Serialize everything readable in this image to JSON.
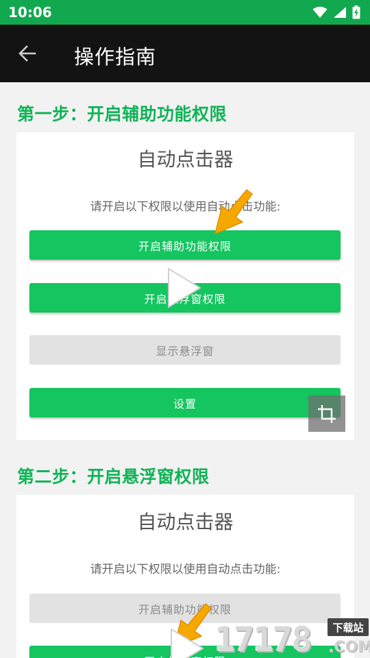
{
  "status_bar": {
    "time": "10:06",
    "icons": [
      "wifi-icon",
      "signal-icon",
      "battery-icon"
    ]
  },
  "app_bar": {
    "back_icon": "arrow-left-icon",
    "title": "操作指南"
  },
  "steps": [
    {
      "heading": "第一步：开启辅助功能权限",
      "card": {
        "title": "自动点击器",
        "subtitle": "请开启以下权限以使用自动点击功能:",
        "buttons": [
          {
            "label": "开启辅助功能权限",
            "style": "green"
          },
          {
            "label": "开启悬浮窗权限",
            "style": "green"
          },
          {
            "label": "显示悬浮窗",
            "style": "gray"
          },
          {
            "label": "设置",
            "style": "green"
          }
        ]
      }
    },
    {
      "heading": "第二步：开启悬浮窗权限",
      "card": {
        "title": "自动点击器",
        "subtitle": "请开启以下权限以使用自动点击功能:",
        "buttons": [
          {
            "label": "开启辅助功能权限",
            "style": "gray"
          },
          {
            "label": "开启悬浮窗权限",
            "style": "green"
          }
        ]
      }
    }
  ],
  "overlays": {
    "play_icon": "play-icon",
    "pointer_arrow_icon": "pointer-arrow-icon",
    "crop_icon": "crop-icon"
  },
  "watermark": {
    "digits": "17178",
    "domain": ".COM",
    "site": "下载站"
  },
  "colors": {
    "status_bar": "#12a84f",
    "app_bar": "#131313",
    "accent_green": "#10b357",
    "button_green": "#14c560",
    "button_gray": "#e2e2e2",
    "arrow_orange": "#f5a800"
  }
}
